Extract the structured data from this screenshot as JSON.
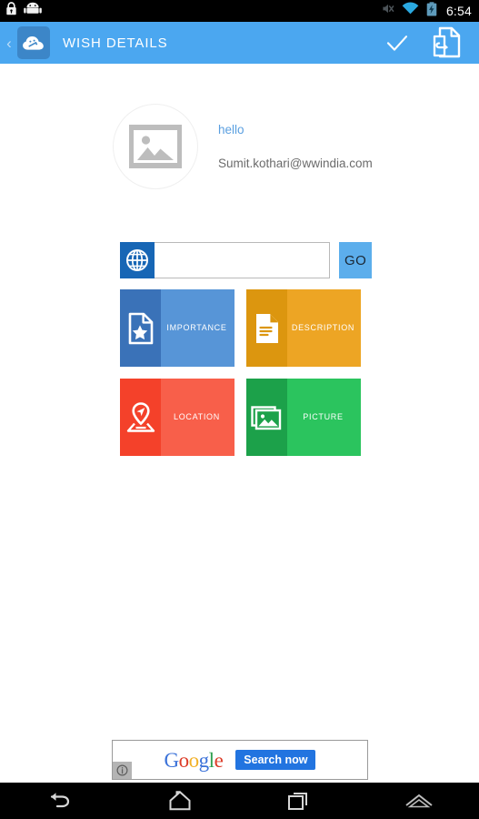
{
  "status_bar": {
    "icons": [
      "lock-icon",
      "android-robot-icon"
    ],
    "right_icons": [
      "volume-mute-icon",
      "wifi-icon",
      "battery-charging-icon"
    ],
    "time": "6:54"
  },
  "app_bar": {
    "back_label": "‹",
    "app_icon_name": "cloud-brain-icon",
    "title": "WISH DETAILS",
    "actions": [
      {
        "name": "done-check-icon",
        "label": "✓"
      },
      {
        "name": "share-document-icon",
        "label": ""
      }
    ]
  },
  "profile": {
    "avatar_icon": "image-placeholder-icon",
    "greeting": "hello",
    "email": "Sumit.kothari@wwindia.com"
  },
  "search": {
    "globe_icon": "globe-icon",
    "value": "",
    "placeholder": "",
    "go_label": "GO"
  },
  "tiles": [
    {
      "label": "IMPORTANCE",
      "icon": "document-star-icon",
      "icon_bg": "#3A72B8",
      "label_bg": "#5795D7"
    },
    {
      "label": "DESCRIPTION",
      "icon": "document-lines-icon",
      "icon_bg": "#DC960F",
      "label_bg": "#EDA524"
    },
    {
      "label": "LOCATION",
      "icon": "map-pin-icon",
      "icon_bg": "#F4412A",
      "label_bg": "#F85F4A"
    },
    {
      "label": "PICTURE",
      "icon": "photo-stack-icon",
      "icon_bg": "#1CA14A",
      "label_bg": "#2BC45E"
    }
  ],
  "ad": {
    "brand_letters": [
      {
        "char": "G",
        "color": "#3C73D9"
      },
      {
        "char": "o",
        "color": "#DC3C28"
      },
      {
        "char": "o",
        "color": "#F2B127"
      },
      {
        "char": "g",
        "color": "#3C73D9"
      },
      {
        "char": "l",
        "color": "#2E9E4F"
      },
      {
        "char": "e",
        "color": "#DC3C28"
      }
    ],
    "cta_label": "Search now",
    "info_label": "ⓘ"
  },
  "nav_bar": {
    "buttons": [
      {
        "name": "nav-back-icon"
      },
      {
        "name": "nav-home-icon"
      },
      {
        "name": "nav-recents-icon"
      },
      {
        "name": "nav-menu-up-icon"
      }
    ]
  },
  "colors": {
    "app_bar": "#4BA7F0",
    "accent_blue": "#5CAEEC",
    "globe_blue": "#1766B5",
    "status_bar": "#000000",
    "content_bg": "#ffffff"
  }
}
